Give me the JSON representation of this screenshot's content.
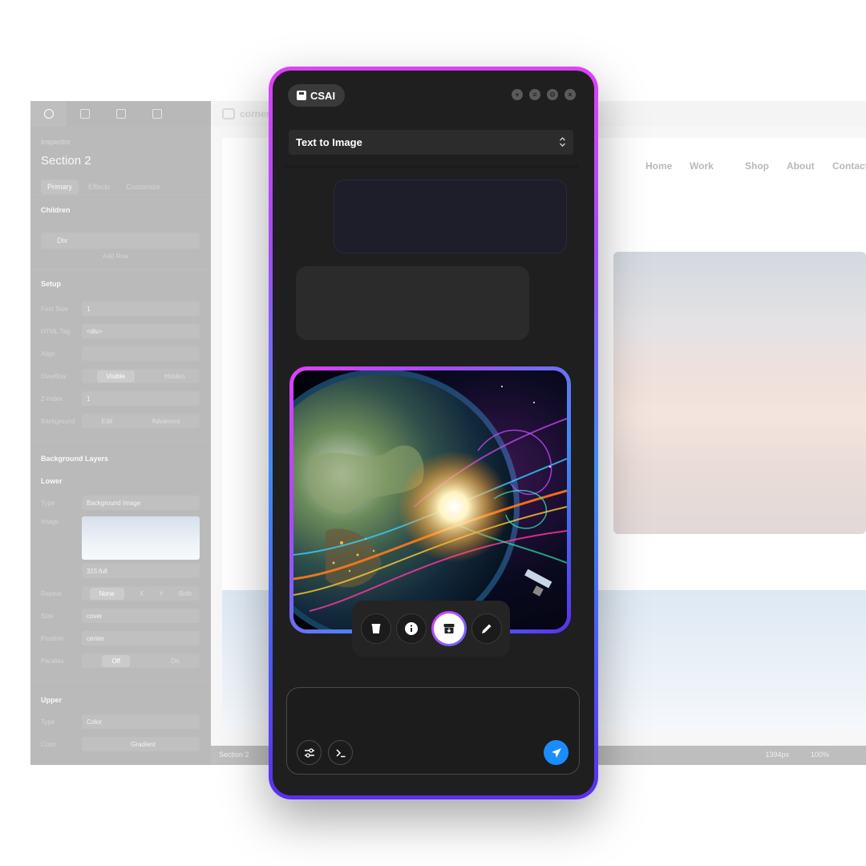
{
  "editor": {
    "inspector_label": "Inspector",
    "section_title": "Section 2",
    "subtabs": [
      "Primary",
      "Effects",
      "Customize"
    ],
    "children_heading": "Children",
    "child_item": "Div",
    "add_row": "Add Row",
    "setup_heading": "Setup",
    "font_size_label": "Font Size",
    "font_size_value": "1",
    "html_tag_label": "HTML Tag",
    "html_tag_value": "<div>",
    "align_label": "Align",
    "overflow_label": "Overflow",
    "overflow_visible": "Visible",
    "overflow_hidden": "Hidden",
    "zindex_label": "Z-Index",
    "zindex_value": "1",
    "background_label": "Background",
    "background_edit": "Edit",
    "background_advanced": "Advanced",
    "bg_layers_heading": "Background Layers",
    "lower_label": "Lower",
    "type_label": "Type",
    "type_value": "Background Image",
    "image_label": "Image",
    "image_value": "315:full",
    "repeat_label": "Repeat",
    "repeat_options": [
      "None",
      "X",
      "Y",
      "Both"
    ],
    "size_label": "Size",
    "size_value": "cover",
    "position_label": "Position",
    "position_value": "center",
    "parallax_label": "Parallax",
    "parallax_off": "Off",
    "parallax_on": "On",
    "upper_label": "Upper",
    "upper_type_value": "Color",
    "color_label": "Color",
    "color_value": "Gradient",
    "logo_text": "corner",
    "nav": [
      "Home",
      "Work",
      "Shop",
      "About",
      "Contact"
    ],
    "status_section": "Section 2",
    "status_px": "1394px",
    "status_zoom": "100%"
  },
  "panel": {
    "brand_label": "CSAI",
    "window_controls": [
      "plus-icon",
      "list-icon",
      "gear-icon",
      "close-icon"
    ],
    "mode": "Text to Image",
    "toolbar_icons": [
      "trash-icon",
      "info-icon",
      "archive-download-icon",
      "pencil-icon"
    ],
    "composer_placeholder": "",
    "accent": "#1a8cff",
    "gradient_start": "#e040fb",
    "gradient_end": "#5a2ff0"
  }
}
